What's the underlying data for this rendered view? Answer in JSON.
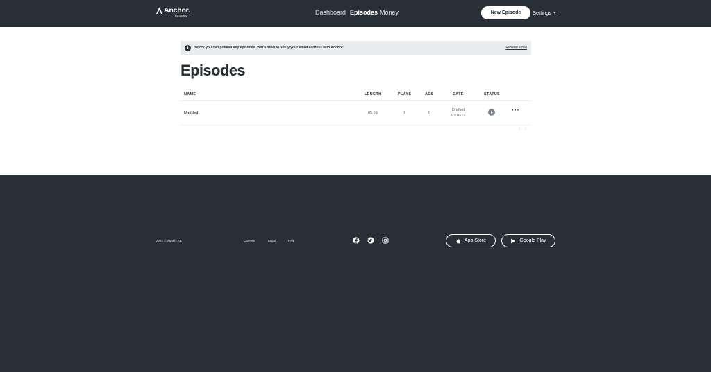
{
  "header": {
    "logo_text": "Anchor.",
    "logo_sub": "by Spotify",
    "nav": [
      {
        "label": "Dashboard"
      },
      {
        "label": "Episodes"
      },
      {
        "label": "Money"
      }
    ],
    "new_episode_label": "New Episode",
    "settings_label": "Settings"
  },
  "alert": {
    "text": "Before you can publish any episodes, you'll need to verify your email address with Anchor.",
    "link": "Resend email"
  },
  "page_title": "Episodes",
  "table": {
    "columns": [
      "NAME",
      "LENGTH",
      "PLAYS",
      "ADS",
      "DATE",
      "STATUS"
    ],
    "rows": [
      {
        "name": "Untitled",
        "length": "05:56",
        "plays": "0",
        "ads": "0",
        "date_status": "Drafted",
        "date": "10/16/22"
      }
    ]
  },
  "footer": {
    "copyright": "2022 © Spotify AB",
    "links": [
      "Careers",
      "Legal",
      "Help"
    ],
    "social": [
      "facebook-icon",
      "twitter-icon",
      "instagram-icon"
    ],
    "app_store_label": "App Store",
    "google_play_label": "Google Play"
  },
  "colors": {
    "dark": "#292f36",
    "alert_bg": "#eaecef"
  }
}
